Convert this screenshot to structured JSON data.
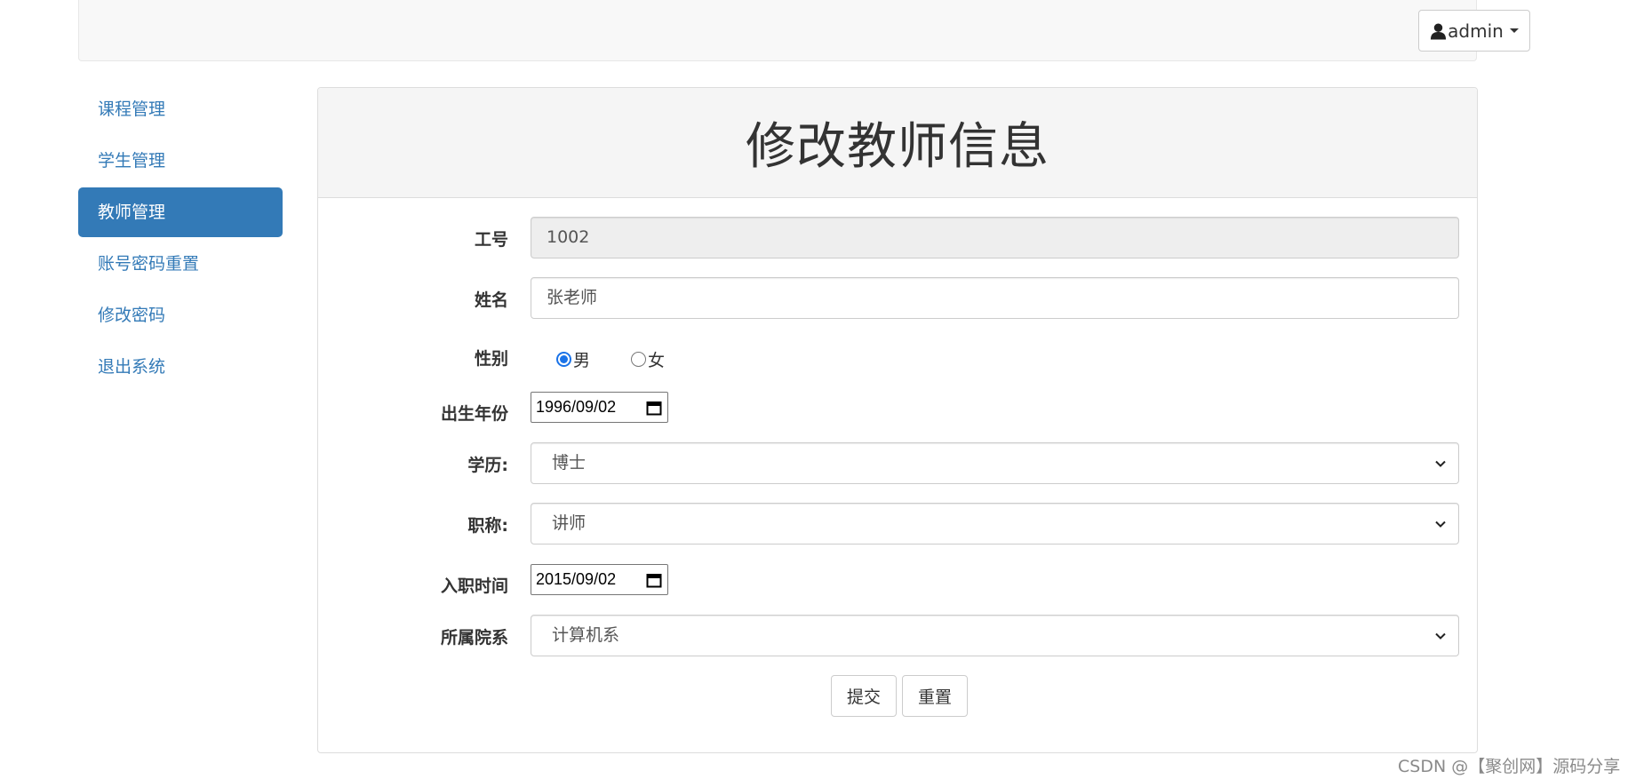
{
  "navbar": {
    "user_label": "admin",
    "user_icon": "user-icon"
  },
  "sidebar": {
    "items": [
      {
        "label": "课程管理",
        "active": false
      },
      {
        "label": "学生管理",
        "active": false
      },
      {
        "label": "教师管理",
        "active": true
      },
      {
        "label": "账号密码重置",
        "active": false
      },
      {
        "label": "修改密码",
        "active": false
      },
      {
        "label": "退出系统",
        "active": false
      }
    ]
  },
  "panel": {
    "title": "修改教师信息"
  },
  "form": {
    "id_label": "工号",
    "id_value": "1002",
    "name_label": "姓名",
    "name_value": "张老师",
    "gender_label": "性别",
    "gender_options": [
      "男",
      "女"
    ],
    "gender_selected": "男",
    "birth_label": "出生年份",
    "birth_value": "1996/09/02",
    "degree_label": "学历:",
    "degree_value": "博士",
    "title_label": "职称:",
    "title_value": "讲师",
    "hire_label": "入职时间",
    "hire_value": "2015/09/02",
    "dept_label": "所属院系",
    "dept_value": "计算机系",
    "submit_label": "提交",
    "reset_label": "重置"
  },
  "watermark": "CSDN @【聚创网】源码分享",
  "colors": {
    "primary": "#337ab7",
    "radio_accent": "#1a73e8"
  }
}
